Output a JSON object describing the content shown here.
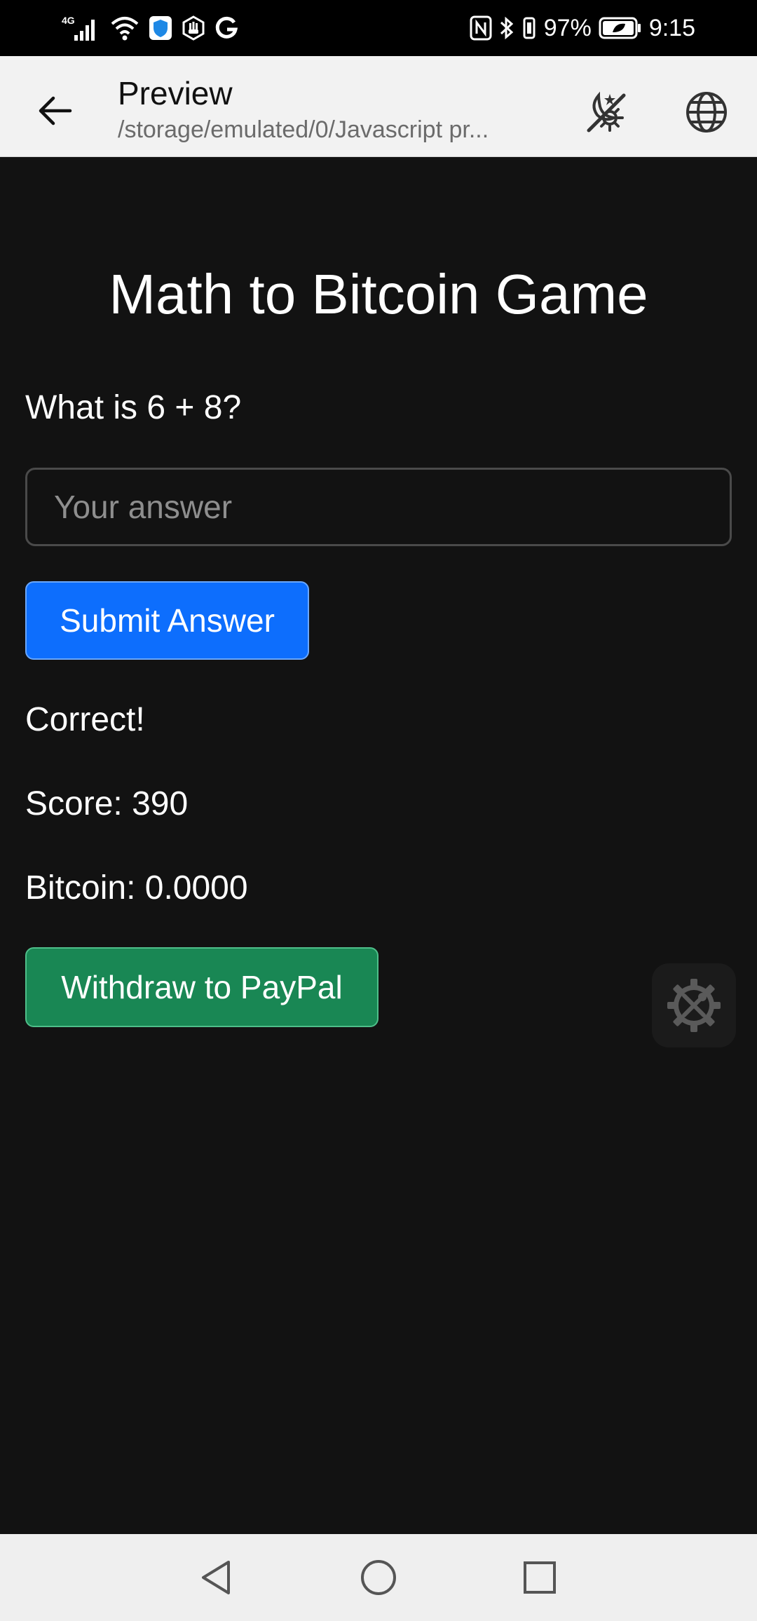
{
  "status_bar": {
    "network": "4G",
    "battery": "97%",
    "time": "9:15"
  },
  "app_bar": {
    "title": "Preview",
    "subtitle": "/storage/emulated/0/Javascript pr..."
  },
  "game": {
    "title": "Math to Bitcoin Game",
    "question": "What is 6 + 8?",
    "answer_placeholder": "Your answer",
    "submit_label": "Submit Answer",
    "feedback": "Correct!",
    "score": "Score: 390",
    "bitcoin": "Bitcoin: 0.0000",
    "withdraw_label": "Withdraw to PayPal"
  },
  "colors": {
    "background": "#121212",
    "primary_button": "#0d6efd",
    "success_button": "#198754"
  },
  "icons": {
    "back": "arrow-left-icon",
    "theme": "day-night-icon",
    "globe": "globe-icon",
    "tools": "settings-tools-icon",
    "nav_back": "triangle-back-icon",
    "nav_home": "circle-home-icon",
    "nav_recents": "square-recents-icon"
  }
}
